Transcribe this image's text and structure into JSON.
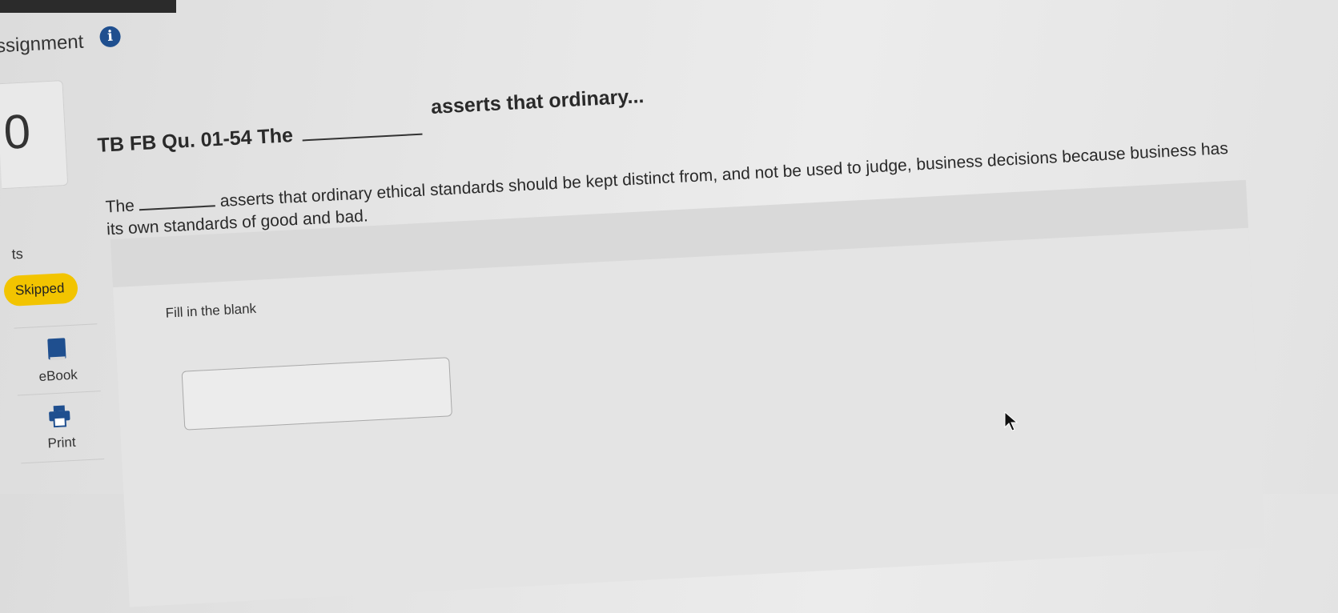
{
  "header": {
    "title": "ssignment",
    "info_icon": "info-icon"
  },
  "score": {
    "value": "0",
    "points_label": "ts"
  },
  "status": {
    "badge": "Skipped",
    "color": "#f2c400"
  },
  "tools": [
    {
      "label": "eBook",
      "icon": "book-icon"
    },
    {
      "label": "Print",
      "icon": "printer-icon"
    }
  ],
  "question": {
    "title_prefix": "TB FB Qu. 01-54 The",
    "title_suffix": "asserts that ordinary...",
    "body_prefix": "The",
    "body_suffix": "asserts that ordinary ethical standards should be kept distinct from, and not be used to judge, business decisions because business has its own standards of good and bad."
  },
  "answer": {
    "instruction": "Fill in the blank",
    "value": ""
  },
  "colors": {
    "accent": "#1f4f8f",
    "skipped": "#f2c400"
  }
}
